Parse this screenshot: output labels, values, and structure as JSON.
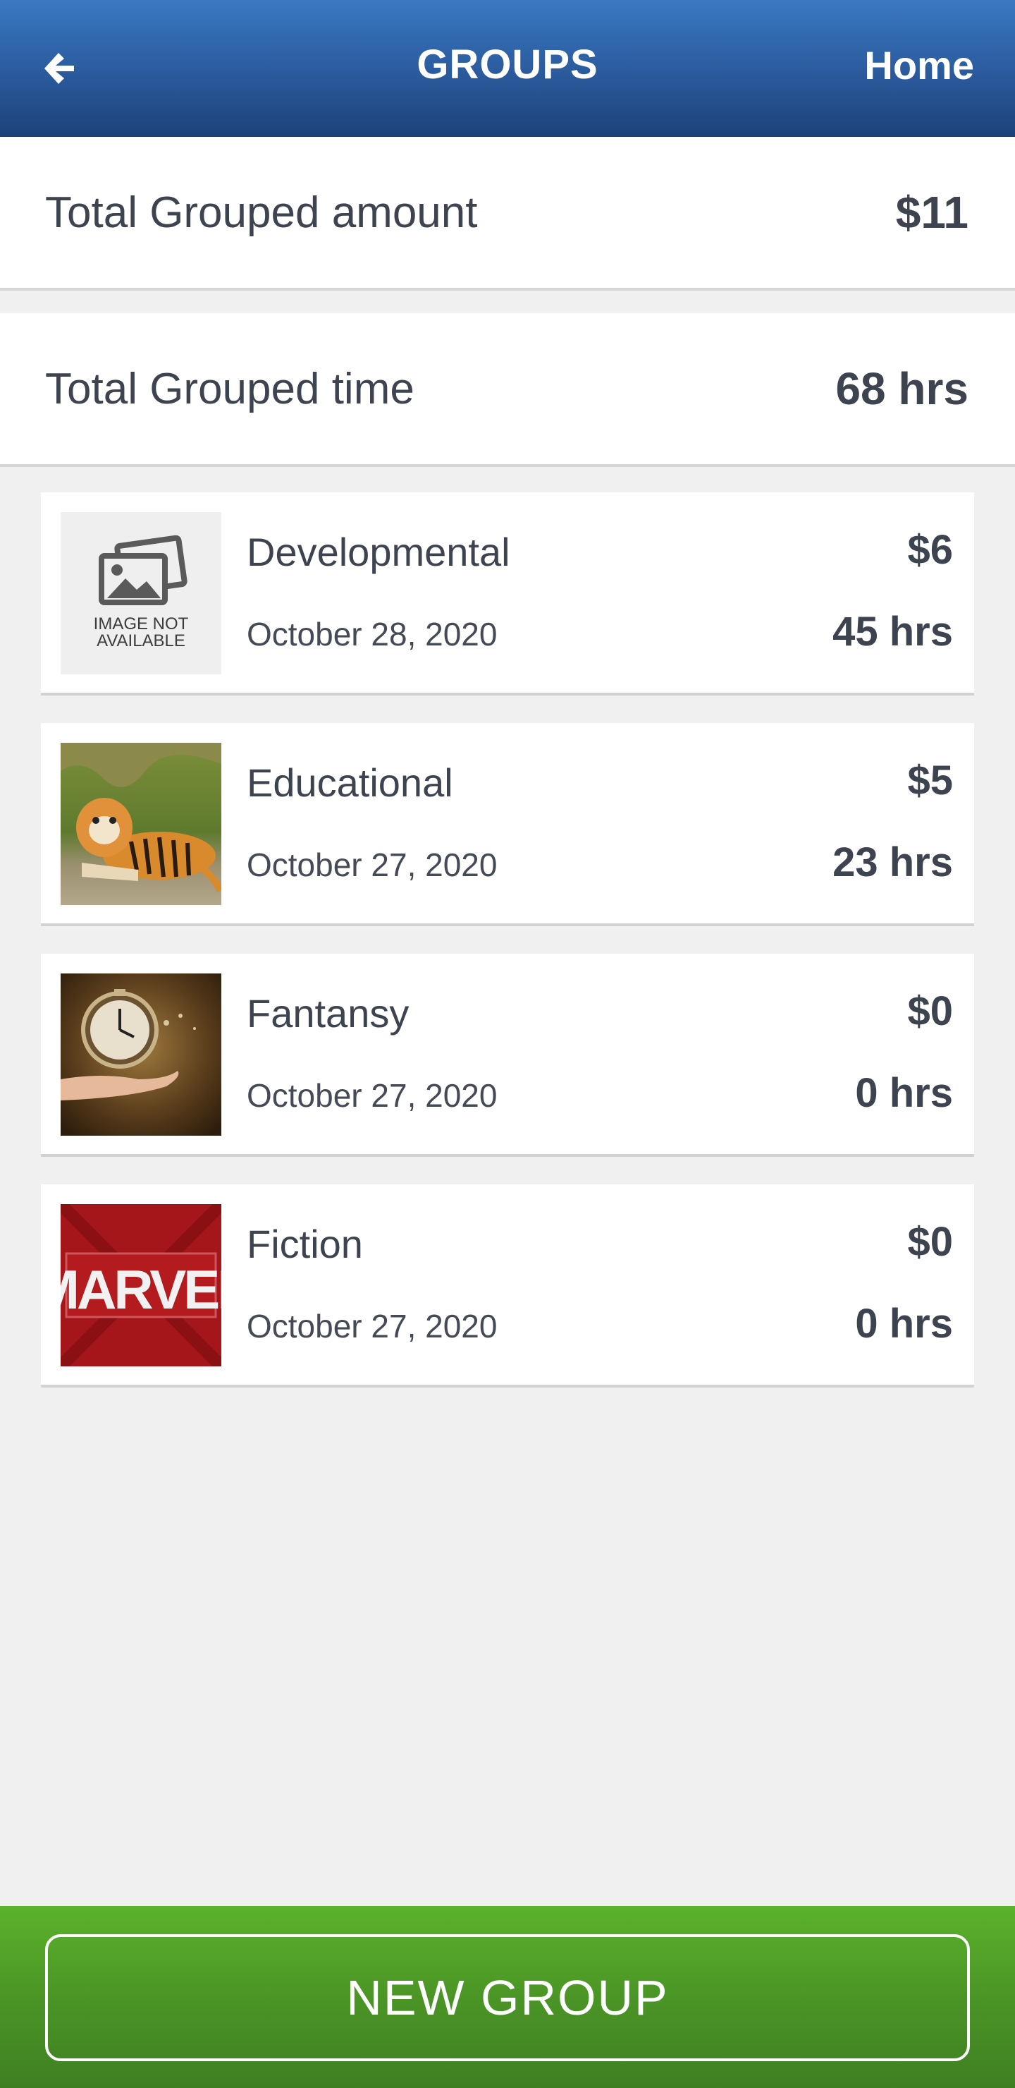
{
  "header": {
    "title": "GROUPS",
    "home_label": "Home",
    "back_icon": "arrow-left-icon"
  },
  "summary": {
    "amount_label": "Total Grouped amount",
    "amount_value": "$11",
    "time_label": "Total Grouped time",
    "time_value": "68 hrs"
  },
  "groups": [
    {
      "name": "Developmental",
      "date": "October 28, 2020",
      "amount": "$6",
      "hours": "45 hrs",
      "image": "image-not-available",
      "placeholder_line1": "IMAGE NOT",
      "placeholder_line2": "AVAILABLE"
    },
    {
      "name": "Educational",
      "date": "October 27, 2020",
      "amount": "$5",
      "hours": "23 hrs",
      "image": "tiger-photo"
    },
    {
      "name": "Fantansy",
      "date": "October 27, 2020",
      "amount": "$0",
      "hours": "0 hrs",
      "image": "clock-in-hand-photo"
    },
    {
      "name": "Fiction",
      "date": "October 27, 2020",
      "amount": "$0",
      "hours": "0 hrs",
      "image": "marvel-logo",
      "logo_text": "MARVEL"
    }
  ],
  "footer": {
    "button_label": "NEW GROUP"
  },
  "colors": {
    "header": "#2a5a9c",
    "footer": "#4b9526",
    "background": "#f0f0f0",
    "text": "#3d4450"
  }
}
